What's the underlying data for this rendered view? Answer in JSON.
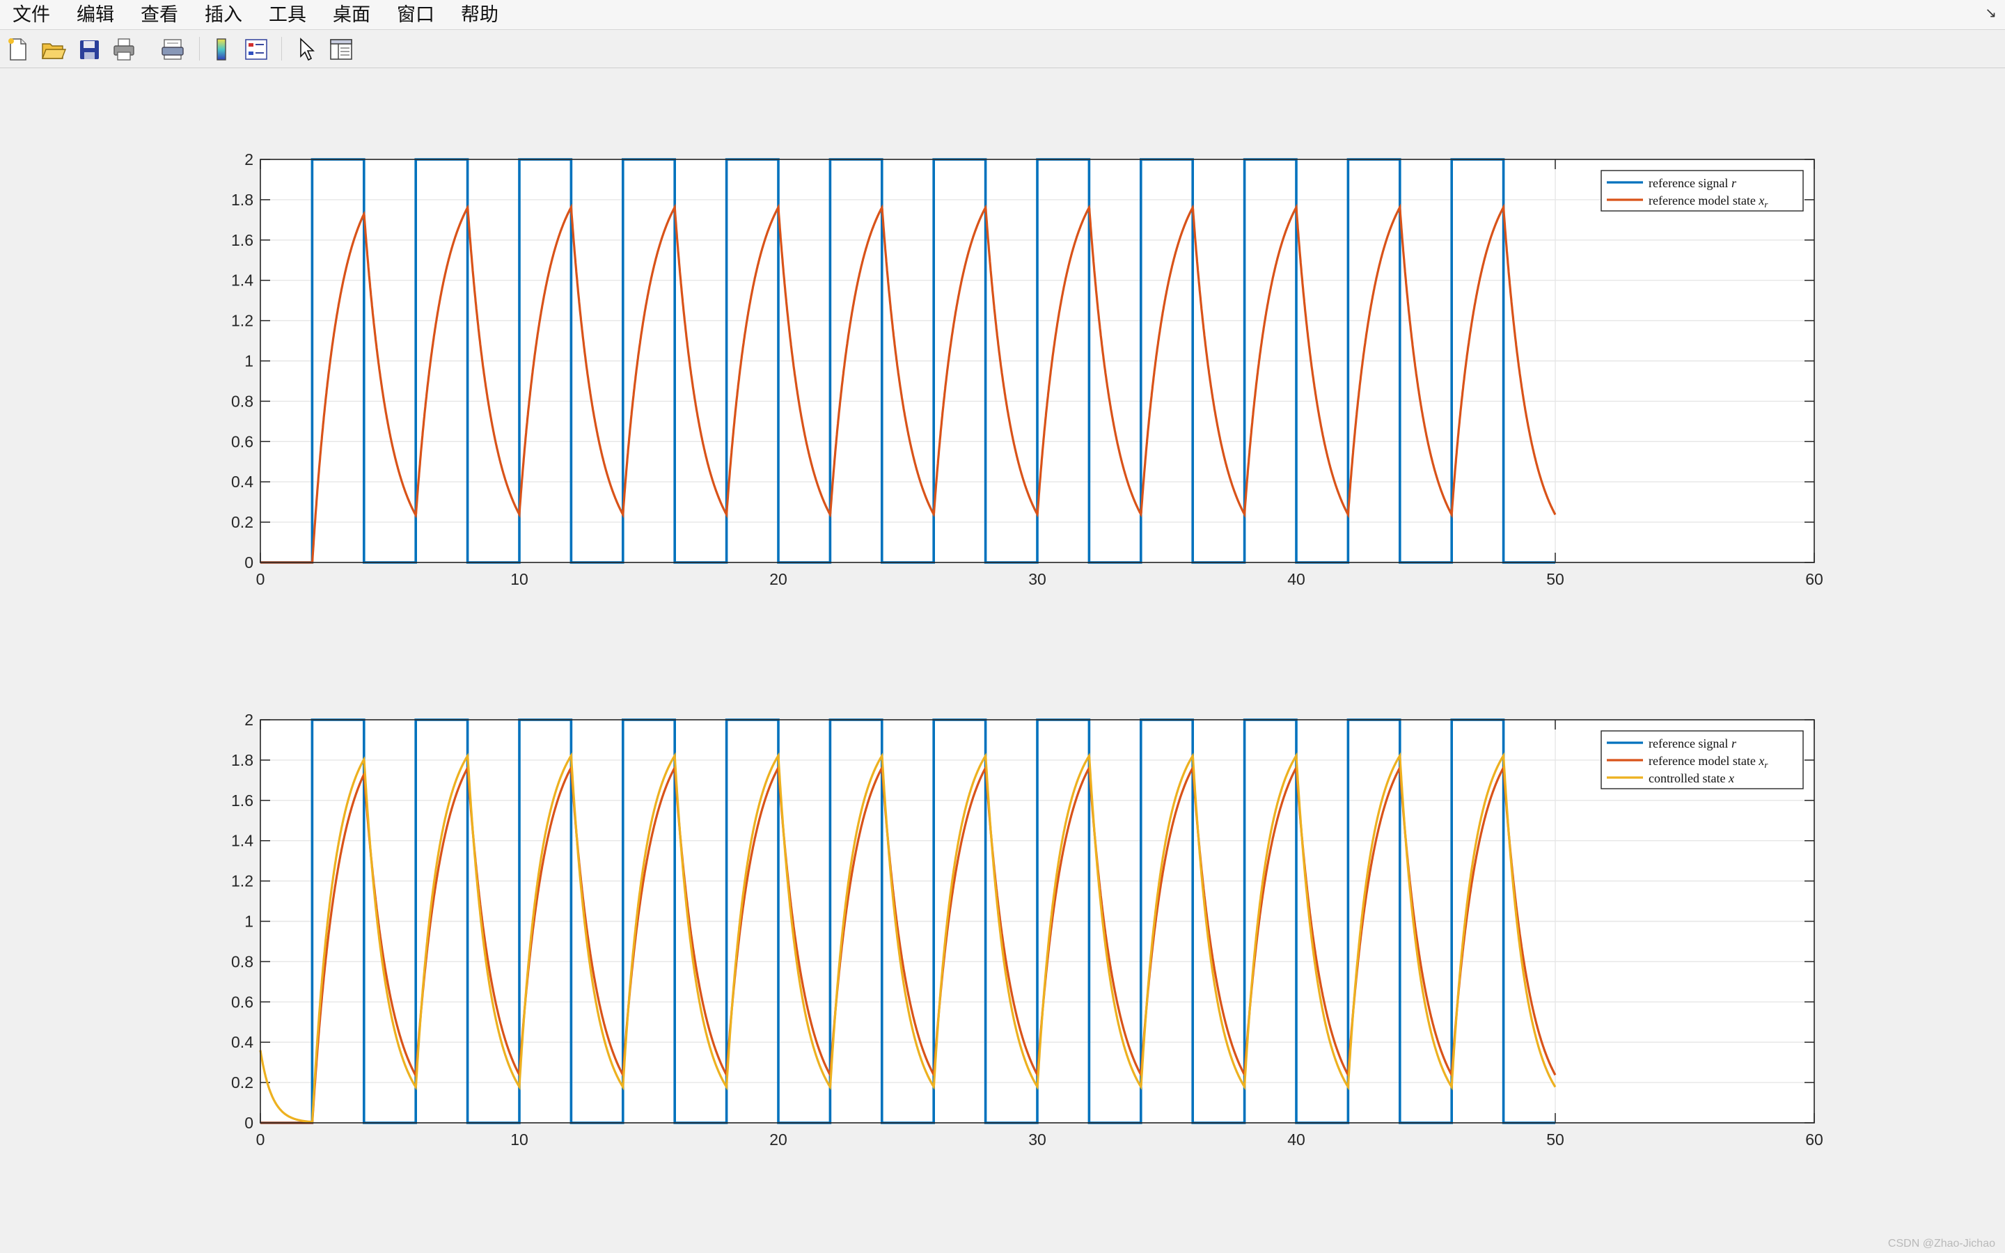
{
  "menu": {
    "items": [
      "文件",
      "编辑",
      "查看",
      "插入",
      "工具",
      "桌面",
      "窗口",
      "帮助"
    ],
    "corner_icon": "undock-arrow-icon"
  },
  "toolbar": {
    "buttons": [
      {
        "name": "new-figure-button",
        "icon": "new-file-icon"
      },
      {
        "name": "open-file-button",
        "icon": "folder-open-icon"
      },
      {
        "name": "save-button",
        "icon": "save-disk-icon"
      },
      {
        "name": "print-button",
        "icon": "printer-icon"
      },
      {
        "name": "print-preview-button",
        "icon": "print-preview-icon"
      },
      {
        "name": "insert-colorbar-button",
        "icon": "colorbar-icon"
      },
      {
        "name": "insert-legend-button",
        "icon": "legend-icon"
      },
      {
        "name": "edit-plot-button",
        "icon": "pointer-arrow-icon"
      },
      {
        "name": "property-inspector-button",
        "icon": "property-panel-icon"
      }
    ]
  },
  "colors": {
    "reference_signal": "#0072BD",
    "reference_model": "#D95319",
    "controlled_state": "#EDB120",
    "axes_bg": "#ffffff",
    "figure_bg": "#f0f0f0"
  },
  "chart_data": [
    {
      "type": "line",
      "xlim": [
        0,
        60
      ],
      "ylim": [
        0,
        2
      ],
      "xticks": [
        0,
        10,
        20,
        30,
        40,
        50,
        60
      ],
      "yticks": [
        0,
        0.2,
        0.4,
        0.6,
        0.8,
        1,
        1.2,
        1.4,
        1.6,
        1.8,
        2
      ],
      "xtick_labels": [
        "0",
        "10",
        "20",
        "30",
        "40",
        "50",
        "60"
      ],
      "ytick_labels": [
        "0",
        "0.2",
        "0.4",
        "0.6",
        "0.8",
        "1",
        "1.2",
        "1.4",
        "1.6",
        "1.8",
        "2"
      ],
      "grid": true,
      "legend_position": "top-right",
      "legend": [
        {
          "prefix": "reference signal ",
          "math": "r",
          "sub": ""
        },
        {
          "prefix": "reference model state ",
          "math": "x",
          "sub": "r"
        }
      ],
      "series": [
        {
          "name": "reference signal r",
          "signal": "square wave",
          "t_end": 50,
          "initial_zero_until": 2,
          "high": 2,
          "low": 0,
          "high_duration": 2,
          "low_duration": 2,
          "first_rise": 2
        },
        {
          "name": "reference model state x_r",
          "signal": "first-order response to r",
          "t_end": 50,
          "time_constant": 1,
          "peak": 1.92,
          "trough": 0.29
        }
      ]
    },
    {
      "type": "line",
      "xlim": [
        0,
        60
      ],
      "ylim": [
        0,
        2
      ],
      "xticks": [
        0,
        10,
        20,
        30,
        40,
        50,
        60
      ],
      "yticks": [
        0,
        0.2,
        0.4,
        0.6,
        0.8,
        1,
        1.2,
        1.4,
        1.6,
        1.8,
        2
      ],
      "xtick_labels": [
        "0",
        "10",
        "20",
        "30",
        "40",
        "50",
        "60"
      ],
      "ytick_labels": [
        "0",
        "0.2",
        "0.4",
        "0.6",
        "0.8",
        "1",
        "1.2",
        "1.4",
        "1.6",
        "1.8",
        "2"
      ],
      "grid": true,
      "legend_position": "top-right",
      "legend": [
        {
          "prefix": "reference signal ",
          "math": "r",
          "sub": ""
        },
        {
          "prefix": "reference model state ",
          "math": "x",
          "sub": "r"
        },
        {
          "prefix": "controlled state ",
          "math": "x",
          "sub": ""
        }
      ],
      "series": [
        {
          "name": "reference signal r",
          "signal": "square wave",
          "t_end": 50,
          "initial_zero_until": 2,
          "high": 2,
          "low": 0,
          "high_duration": 2,
          "low_duration": 2,
          "first_rise": 2
        },
        {
          "name": "reference model state x_r",
          "signal": "first-order response to r",
          "t_end": 50,
          "time_constant": 1,
          "peak": 1.92,
          "trough": 0.29
        },
        {
          "name": "controlled state x",
          "signal": "adaptive response tracking x_r",
          "t_end": 50,
          "initial_value": 0.36,
          "peak": 1.95,
          "trough": 0.26
        }
      ]
    }
  ],
  "watermark": "CSDN @Zhao-Jichao"
}
